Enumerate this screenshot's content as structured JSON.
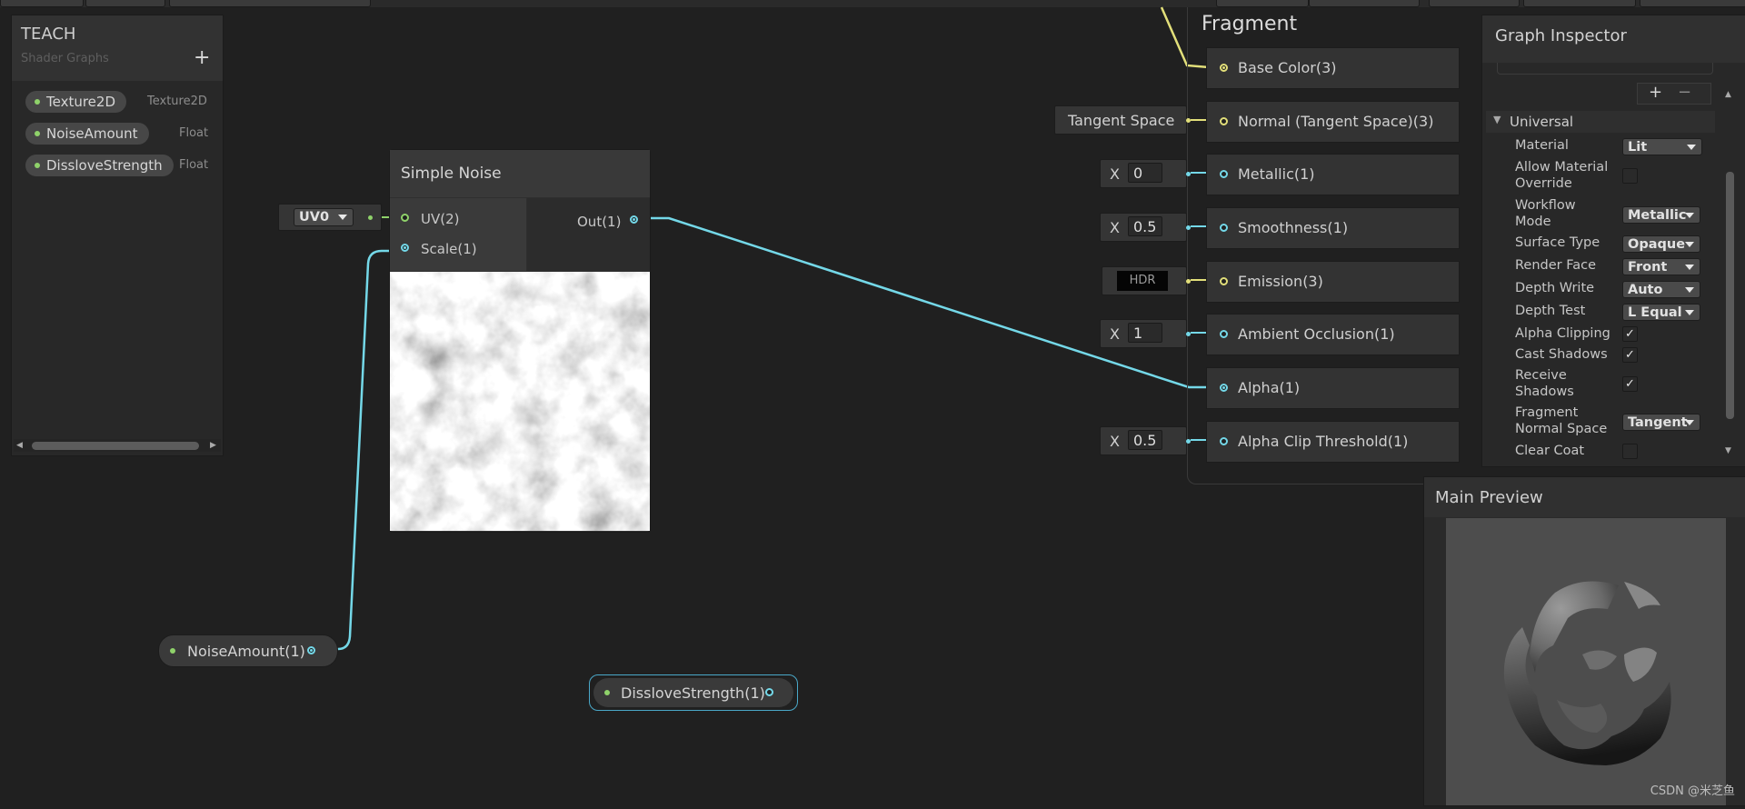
{
  "colors": {
    "background": "#202020",
    "float_wire": "#74d8e8",
    "vector_wire": "#e2df7a",
    "property_dot": "#8fd26a",
    "selection_outline": "#4aa8c8"
  },
  "blackboard": {
    "title": "TEACH",
    "subtitle": "Shader Graphs",
    "add_icon": "plus-icon",
    "properties": [
      {
        "name": "Texture2D",
        "type": "Texture2D"
      },
      {
        "name": "NoiseAmount",
        "type": "Float"
      },
      {
        "name": "DissloveStrength",
        "type": "Float"
      }
    ]
  },
  "simple_noise": {
    "title": "Simple Noise",
    "inputs": {
      "uv": "UV(2)",
      "scale": "Scale(1)"
    },
    "output": "Out(1)",
    "uv_dropdown": "UV0"
  },
  "property_nodes": {
    "noise_amount": "NoiseAmount(1)",
    "disslove_strength": "DissloveStrength(1)"
  },
  "fragment": {
    "title": "Fragment",
    "blocks": [
      {
        "label": "Base Color(3)",
        "port": "yellow",
        "connected": true,
        "input": null
      },
      {
        "label": "Normal (Tangent Space)(3)",
        "port": "yellow",
        "connected": false,
        "input": {
          "kind": "label",
          "text": "Tangent Space"
        }
      },
      {
        "label": "Metallic(1)",
        "port": "cyan",
        "connected": false,
        "input": {
          "kind": "x",
          "x": "X",
          "value": "0"
        }
      },
      {
        "label": "Smoothness(1)",
        "port": "cyan",
        "connected": false,
        "input": {
          "kind": "x",
          "x": "X",
          "value": "0.5"
        }
      },
      {
        "label": "Emission(3)",
        "port": "yellow",
        "connected": false,
        "input": {
          "kind": "hdr",
          "text": "HDR"
        }
      },
      {
        "label": "Ambient Occlusion(1)",
        "port": "cyan",
        "connected": false,
        "input": {
          "kind": "x",
          "x": "X",
          "value": "1"
        }
      },
      {
        "label": "Alpha(1)",
        "port": "cyan",
        "connected": true,
        "input": null
      },
      {
        "label": "Alpha Clip Threshold(1)",
        "port": "cyan",
        "connected": false,
        "input": {
          "kind": "x",
          "x": "X",
          "value": "0.5"
        }
      }
    ]
  },
  "inspector": {
    "title": "Graph Inspector",
    "list_buttons": {
      "add": "+",
      "remove": "−"
    },
    "section": "Universal",
    "rows": [
      {
        "label": "Material",
        "kind": "dropdown",
        "value": "Lit"
      },
      {
        "label": "Allow Material Override",
        "kind": "checkbox",
        "checked": false
      },
      {
        "label": "Workflow Mode",
        "kind": "dropdown",
        "value": "Metallic"
      },
      {
        "label": "Surface Type",
        "kind": "dropdown",
        "value": "Opaque"
      },
      {
        "label": "Render Face",
        "kind": "dropdown",
        "value": "Front"
      },
      {
        "label": "Depth Write",
        "kind": "dropdown",
        "value": "Auto"
      },
      {
        "label": "Depth Test",
        "kind": "dropdown",
        "value": "L Equal"
      },
      {
        "label": "Alpha Clipping",
        "kind": "checkbox",
        "checked": true
      },
      {
        "label": "Cast Shadows",
        "kind": "checkbox",
        "checked": true
      },
      {
        "label": "Receive Shadows",
        "kind": "checkbox",
        "checked": true
      },
      {
        "label": "Fragment Normal Space",
        "kind": "dropdown",
        "value": "Tangent"
      },
      {
        "label": "Clear Coat",
        "kind": "checkbox",
        "checked": false
      }
    ]
  },
  "main_preview": {
    "title": "Main Preview"
  },
  "watermark": "CSDN @米芝鱼"
}
